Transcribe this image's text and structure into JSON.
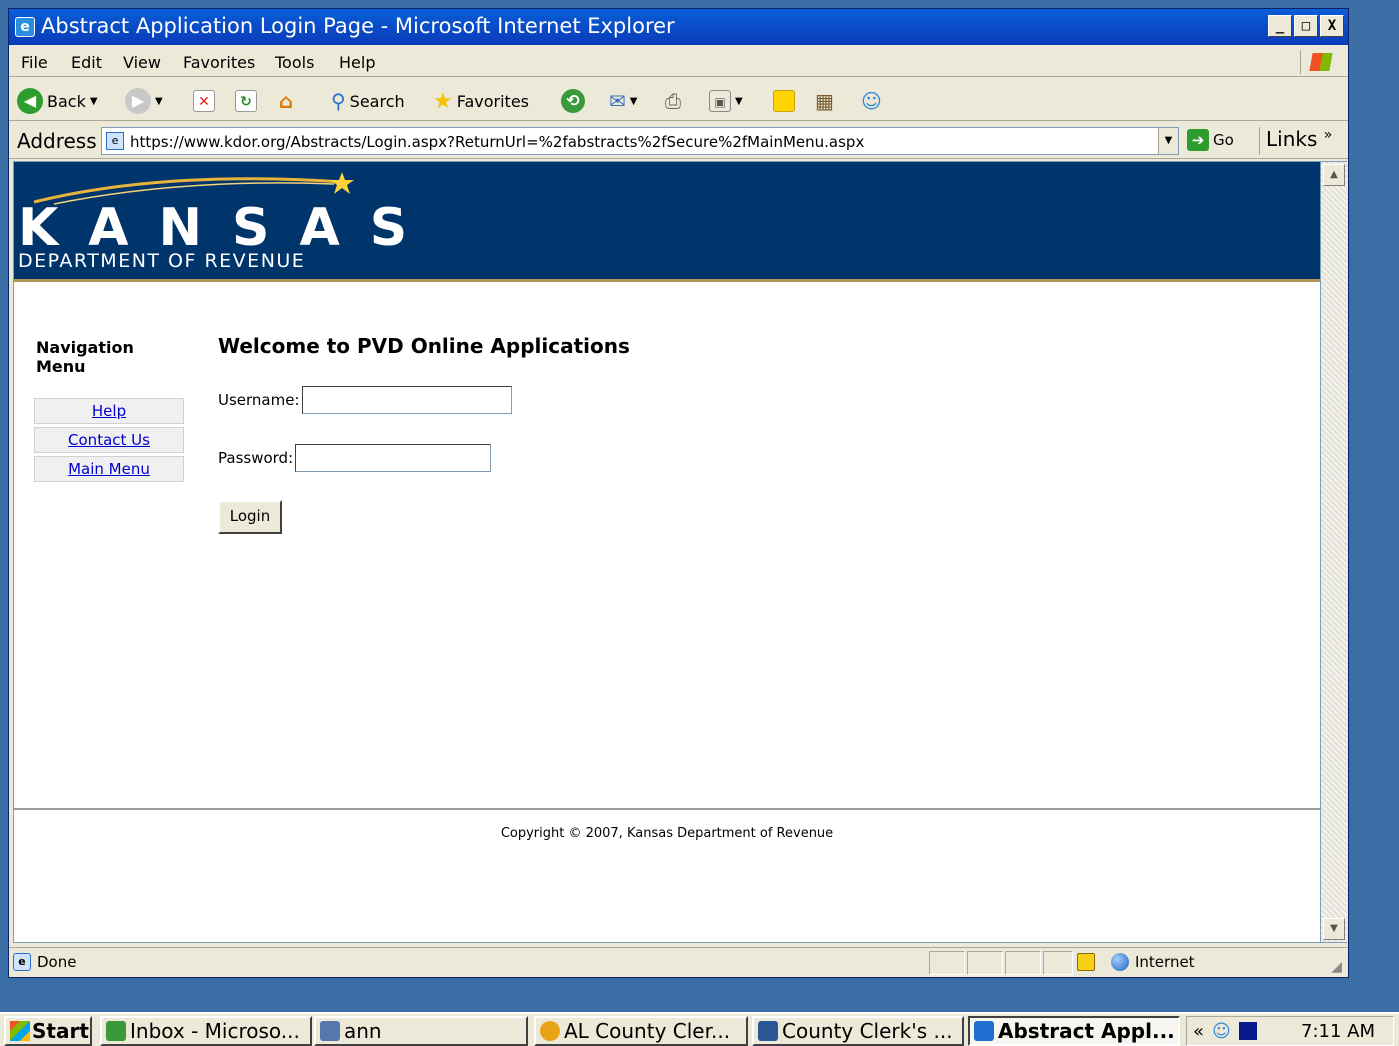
{
  "window": {
    "title": "Abstract Application Login Page - Microsoft Internet Explorer",
    "controls": [
      "_",
      "□",
      "X"
    ]
  },
  "menu": {
    "items": [
      "File",
      "Edit",
      "View",
      "Favorites",
      "Tools",
      "Help"
    ]
  },
  "toolbar": {
    "back_label": "Back",
    "search_label": "Search",
    "favorites_label": "Favorites"
  },
  "address": {
    "label": "Address",
    "url": "https://www.kdor.org/Abstracts/Login.aspx?ReturnUrl=%2fabstracts%2fSecure%2fMainMenu.aspx",
    "go_label": "Go",
    "links_label": "Links"
  },
  "banner": {
    "kansas": "KANSAS",
    "dept": "DEPARTMENT OF REVENUE"
  },
  "nav": {
    "heading": "Navigation Menu",
    "items": [
      {
        "label": "Help"
      },
      {
        "label": "Contact Us"
      },
      {
        "label": "Main Menu"
      }
    ]
  },
  "login": {
    "welcome": "Welcome to PVD Online Applications",
    "username_label": "Username:",
    "username_value": "",
    "password_label": "Password:",
    "password_value": "",
    "button_label": "Login"
  },
  "footer": {
    "copyright": "Copyright © 2007, Kansas Department of Revenue"
  },
  "status": {
    "text": "Done",
    "zone": "Internet"
  },
  "taskbar": {
    "start": "Start",
    "tasks": [
      {
        "label": "Inbox - Microso...",
        "color": "#3a9a3a"
      },
      {
        "label": "ann",
        "color": "#5577aa"
      },
      {
        "label": "AL County Cler...",
        "color": "#e8a317"
      },
      {
        "label": "County Clerk's ...",
        "color": "#2b5797"
      },
      {
        "label": "Abstract Appl...",
        "color": "#1e6fd0"
      }
    ],
    "tray_chevron": "«",
    "clock": "7:11 AM"
  },
  "colors": {
    "banner_bg": "#00356b",
    "banner_accent": "#b49455",
    "link": "#0000cc"
  }
}
